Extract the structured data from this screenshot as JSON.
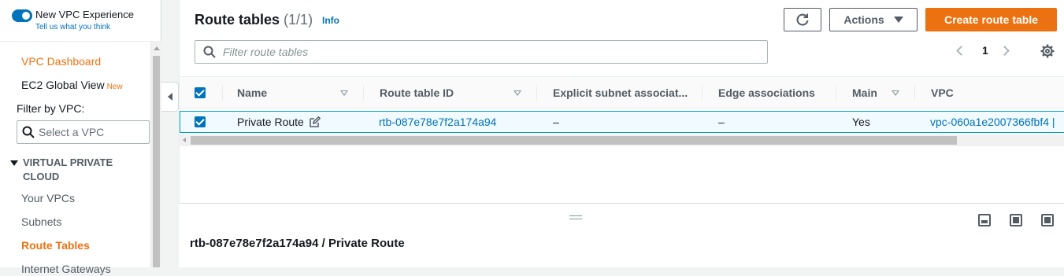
{
  "sidebar": {
    "experience_title": "New VPC Experience",
    "experience_link": "Tell us what you think",
    "dashboard_label": "VPC Dashboard",
    "ec2_label": "EC2 Global View",
    "new_badge": "New",
    "filter_label": "Filter by VPC:",
    "vpc_select_placeholder": "Select a VPC",
    "section_title": "VIRTUAL PRIVATE CLOUD",
    "items": [
      {
        "label": "Your VPCs"
      },
      {
        "label": "Subnets"
      },
      {
        "label": "Route Tables"
      },
      {
        "label": "Internet Gateways"
      }
    ]
  },
  "header": {
    "title": "Route tables",
    "count": "(1/1)",
    "info": "Info",
    "actions_label": "Actions",
    "create_label": "Create route table"
  },
  "search": {
    "placeholder": "Filter route tables"
  },
  "pagination": {
    "current_page": "1"
  },
  "table": {
    "columns": [
      "Name",
      "Route table ID",
      "Explicit subnet associat...",
      "Edge associations",
      "Main",
      "VPC"
    ],
    "rows": [
      {
        "name": "Private Route",
        "route_table_id": "rtb-087e78e7f2a174a94",
        "explicit_subnet": "–",
        "edge": "–",
        "main": "Yes",
        "vpc": "vpc-060a1e2007366fbf4 |"
      }
    ]
  },
  "split_panel": {
    "title": "rtb-087e78e7f2a174a94 / Private Route"
  },
  "colors": {
    "accent": "#ec7211",
    "link": "#0073bb",
    "selected_row": "#f1faff"
  }
}
